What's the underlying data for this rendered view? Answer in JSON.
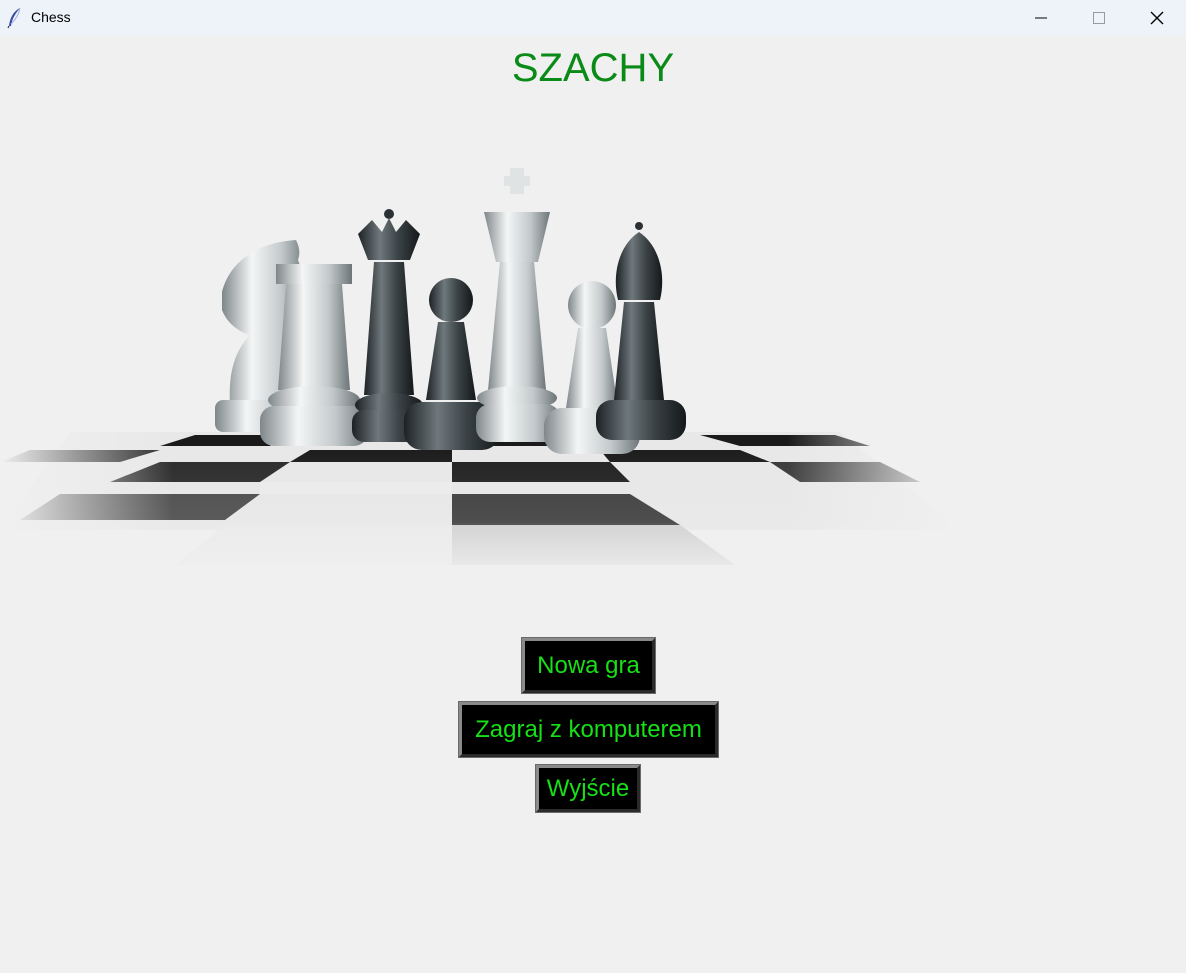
{
  "window": {
    "title": "Chess",
    "icon": "feather-icon",
    "controls": [
      "minimize-icon",
      "maximize-icon",
      "close-icon"
    ]
  },
  "main": {
    "heading": "SZACHY",
    "hero_image": "chess-pieces-on-board-image"
  },
  "menu": {
    "new_game": "Nowa gra",
    "play_computer": "Zagraj z komputerem",
    "exit": "Wyjście"
  },
  "colors": {
    "heading": "#0a8a16",
    "button_bg": "#000000",
    "button_text": "#16e016",
    "background": "#f0f0f0"
  }
}
